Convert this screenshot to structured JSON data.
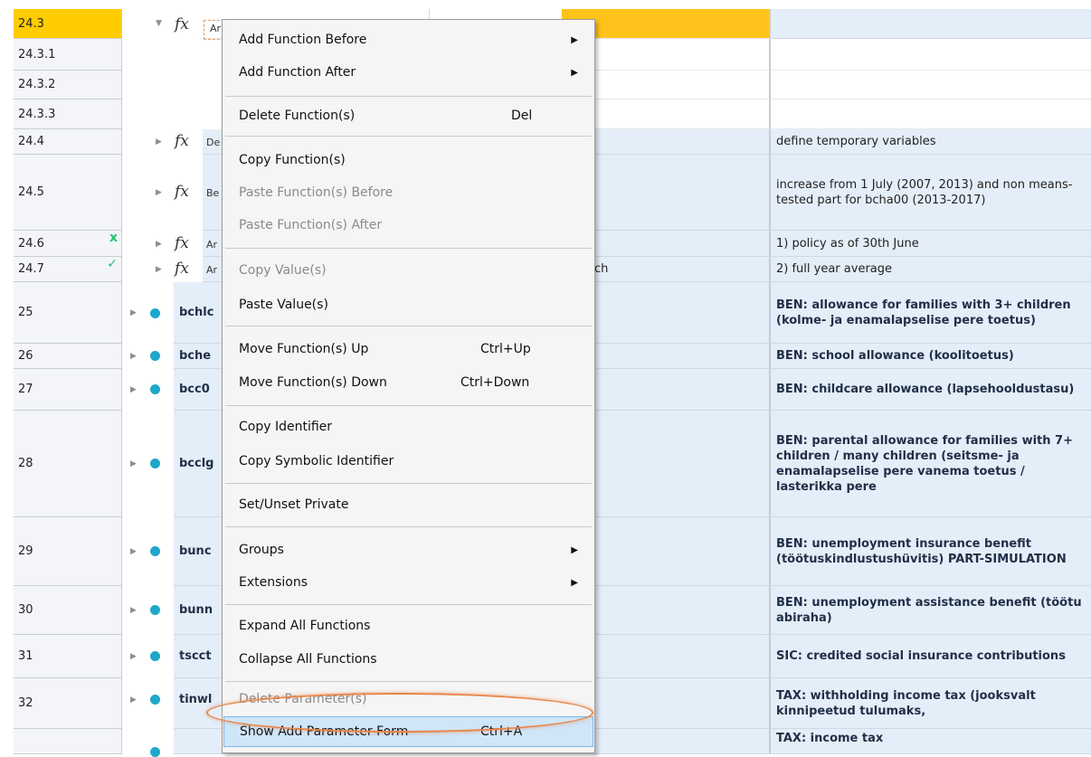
{
  "rows": [
    {
      "id": "24.3",
      "selected": true
    },
    {
      "id": "24.3.1"
    },
    {
      "id": "24.3.2"
    },
    {
      "id": "24.3.3"
    },
    {
      "id": "24.4",
      "desc": "define temporary variables",
      "fn_short": "De"
    },
    {
      "id": "24.5",
      "desc": "increase from 1 July (2007, 2013) and non means-tested part for bcha00 (2013-2017)",
      "fn_short": "Be"
    },
    {
      "id": "24.6",
      "desc": "1) policy as of 30th June",
      "fn_short": "Ar",
      "mark": "x"
    },
    {
      "id": "24.7",
      "desc": "2) full year average",
      "fn_short": "Ar",
      "mark": "✓",
      "mid_text": "ch"
    },
    {
      "id": "25",
      "name": "bchlc",
      "desc": "BEN: allowance for families with 3+ children (kolme- ja enamalapselise pere toetus)"
    },
    {
      "id": "26",
      "name": "bche",
      "desc": "BEN: school allowance (koolitoetus)"
    },
    {
      "id": "27",
      "name": "bcc0",
      "desc": "BEN: childcare allowance (lapsehooldustasu)"
    },
    {
      "id": "28",
      "name": "bcclg",
      "desc": "BEN: parental allowance for families with 7+ children / many children (seitsme- ja enamalapselise pere vanema toetus / lasterikka pere"
    },
    {
      "id": "29",
      "name": "bunc",
      "desc": "BEN: unemployment insurance benefit (töötuskindlustushüvitis) PART-SIMULATION"
    },
    {
      "id": "30",
      "name": "bunn",
      "desc": "BEN: unemployment assistance benefit (töötu abiraha)"
    },
    {
      "id": "31",
      "name": "tscct",
      "desc": "SIC: credited social insurance contributions"
    },
    {
      "id": "32",
      "name": "tinwl",
      "desc": "TAX: withholding income tax (jooksvalt kinnipeetud tulumaks,"
    },
    {
      "id": "",
      "name": "",
      "desc": "TAX: income tax"
    }
  ],
  "top_fn_short": "Ar",
  "menu": {
    "items": [
      {
        "label": "Add Function Before",
        "submenu": true
      },
      {
        "label": "Add Function After",
        "submenu": true
      },
      {
        "label": "Delete Function(s)",
        "shortcut": "Del"
      },
      {
        "label": "Copy Function(s)"
      },
      {
        "label": "Paste Function(s) Before",
        "disabled": true
      },
      {
        "label": "Paste Function(s) After",
        "disabled": true
      },
      {
        "label": "Copy Value(s)",
        "disabled": true
      },
      {
        "label": "Paste Value(s)"
      },
      {
        "label": "Move Function(s) Up",
        "shortcut": "Ctrl+Up"
      },
      {
        "label": "Move Function(s) Down",
        "shortcut": "Ctrl+Down"
      },
      {
        "label": "Copy Identifier"
      },
      {
        "label": "Copy Symbolic Identifier"
      },
      {
        "label": "Set/Unset Private"
      },
      {
        "label": "Groups",
        "submenu": true
      },
      {
        "label": "Extensions",
        "submenu": true
      },
      {
        "label": "Expand All Functions"
      },
      {
        "label": "Collapse All Functions"
      },
      {
        "label": "Delete Parameter(s)",
        "disabled": true
      },
      {
        "label": "Show Add Parameter Form",
        "shortcut": "Ctrl+A",
        "highlight": true
      }
    ],
    "submenu_arrow": "▶"
  },
  "colors": {
    "selected": "#ffcc00",
    "accent": "#1fa7c9",
    "highlight_oval": "#e8864a"
  }
}
